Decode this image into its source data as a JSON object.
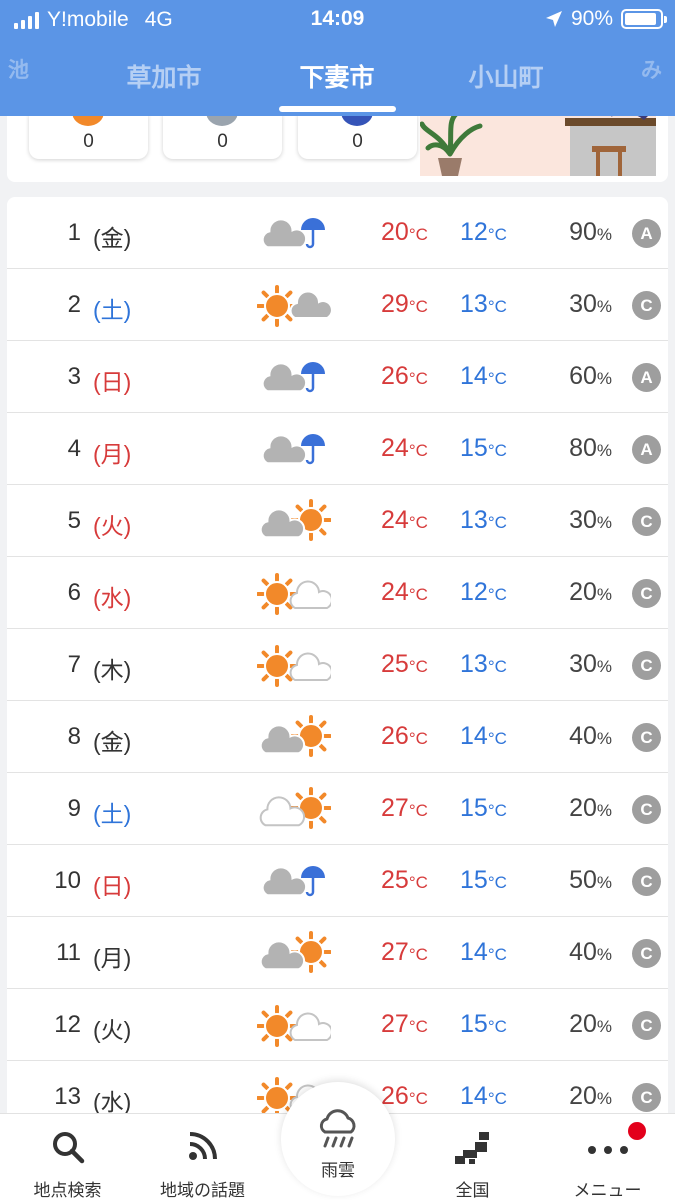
{
  "status_bar": {
    "carrier": "Y!mobile",
    "network": "4G",
    "time": "14:09",
    "battery": "90%",
    "battery_level": 0.9
  },
  "tabs": {
    "left_edge": "池",
    "prev": "草加市",
    "active": "下妻市",
    "next": "小山町",
    "right_edge": "み"
  },
  "top_card": {
    "counts": [
      "0",
      "0",
      "0"
    ]
  },
  "colors": {
    "header": "#5b95e6",
    "high_temp": "#d73b3b",
    "low_temp": "#2f74d9",
    "saturday": "#2f74d9",
    "sunday_holiday": "#d73b3b",
    "sun": "#f2892a",
    "cloud": "#b3b3b3",
    "rain": "#3a70d8",
    "badge": "#9e9e9e",
    "notification": "#e3001b"
  },
  "units": {
    "temp": "°C",
    "pop": "%"
  },
  "forecast": [
    {
      "day": "1",
      "weekday": "(金)",
      "type": "wk",
      "icon": "cloud-rain",
      "high": "20",
      "low": "12",
      "pop": "90",
      "grade": "A"
    },
    {
      "day": "2",
      "weekday": "(土)",
      "type": "sat",
      "icon": "sun-cloud",
      "high": "29",
      "low": "13",
      "pop": "30",
      "grade": "C"
    },
    {
      "day": "3",
      "weekday": "(日)",
      "type": "sun",
      "icon": "cloud-rain",
      "high": "26",
      "low": "14",
      "pop": "60",
      "grade": "A"
    },
    {
      "day": "4",
      "weekday": "(月)",
      "type": "sun",
      "icon": "cloud-rain",
      "high": "24",
      "low": "15",
      "pop": "80",
      "grade": "A"
    },
    {
      "day": "5",
      "weekday": "(火)",
      "type": "sun",
      "icon": "cloud-sun",
      "high": "24",
      "low": "13",
      "pop": "30",
      "grade": "C"
    },
    {
      "day": "6",
      "weekday": "(水)",
      "type": "sun",
      "icon": "sun-light-cloud",
      "high": "24",
      "low": "12",
      "pop": "20",
      "grade": "C"
    },
    {
      "day": "7",
      "weekday": "(木)",
      "type": "wk",
      "icon": "sun-light-cloud",
      "high": "25",
      "low": "13",
      "pop": "30",
      "grade": "C"
    },
    {
      "day": "8",
      "weekday": "(金)",
      "type": "wk",
      "icon": "cloud-sun",
      "high": "26",
      "low": "14",
      "pop": "40",
      "grade": "C"
    },
    {
      "day": "9",
      "weekday": "(土)",
      "type": "sat",
      "icon": "light-cloud-sun",
      "high": "27",
      "low": "15",
      "pop": "20",
      "grade": "C"
    },
    {
      "day": "10",
      "weekday": "(日)",
      "type": "sun",
      "icon": "cloud-rain",
      "high": "25",
      "low": "15",
      "pop": "50",
      "grade": "C"
    },
    {
      "day": "11",
      "weekday": "(月)",
      "type": "wk",
      "icon": "cloud-sun",
      "high": "27",
      "low": "14",
      "pop": "40",
      "grade": "C"
    },
    {
      "day": "12",
      "weekday": "(火)",
      "type": "wk",
      "icon": "sun-light-cloud",
      "high": "27",
      "low": "15",
      "pop": "20",
      "grade": "C"
    },
    {
      "day": "13",
      "weekday": "(水)",
      "type": "wk",
      "icon": "sun-light-cloud",
      "high": "26",
      "low": "14",
      "pop": "20",
      "grade": "C"
    }
  ],
  "bottom_nav": {
    "search": "地点検索",
    "topics": "地域の話題",
    "rain_cloud": "雨雲",
    "national": "全国",
    "menu": "メニュー"
  }
}
